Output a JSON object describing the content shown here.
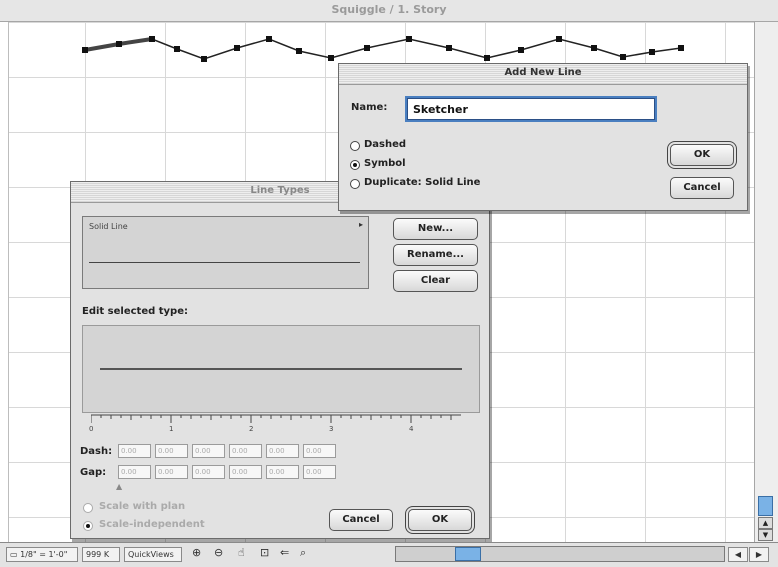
{
  "window": {
    "title": "Squiggle / 1. Story"
  },
  "status_bar": {
    "scale": "1/8\" = 1'-0\"",
    "memory": "999 K",
    "quickviews": "QuickViews"
  },
  "add_new_line": {
    "title": "Add New Line",
    "name_label": "Name:",
    "name_value": "Sketcher",
    "options": [
      {
        "label": "Dashed",
        "selected": false
      },
      {
        "label": "Symbol",
        "selected": true
      },
      {
        "label": "Duplicate:  Solid Line",
        "selected": false
      }
    ],
    "ok_label": "OK",
    "cancel_label": "Cancel"
  },
  "line_types": {
    "title": "Line Types",
    "selected_line": "Solid Line",
    "buttons": {
      "new": "New...",
      "rename": "Rename...",
      "clear": "Clear"
    },
    "edit_label": "Edit selected type:",
    "ruler_labels": [
      "0",
      "1",
      "2",
      "3",
      "4"
    ],
    "dash_label": "Dash:",
    "gap_label": "Gap:",
    "dash_values": [
      "0.00",
      "0.00",
      "0.00",
      "0.00",
      "0.00",
      "0.00"
    ],
    "gap_values": [
      "0.00",
      "0.00",
      "0.00",
      "0.00",
      "0.00",
      "0.00"
    ],
    "scale_options": [
      {
        "label": "Scale with plan",
        "selected": false
      },
      {
        "label": "Scale-independent",
        "selected": true
      }
    ],
    "cancel_label": "Cancel",
    "ok_label": "OK"
  }
}
